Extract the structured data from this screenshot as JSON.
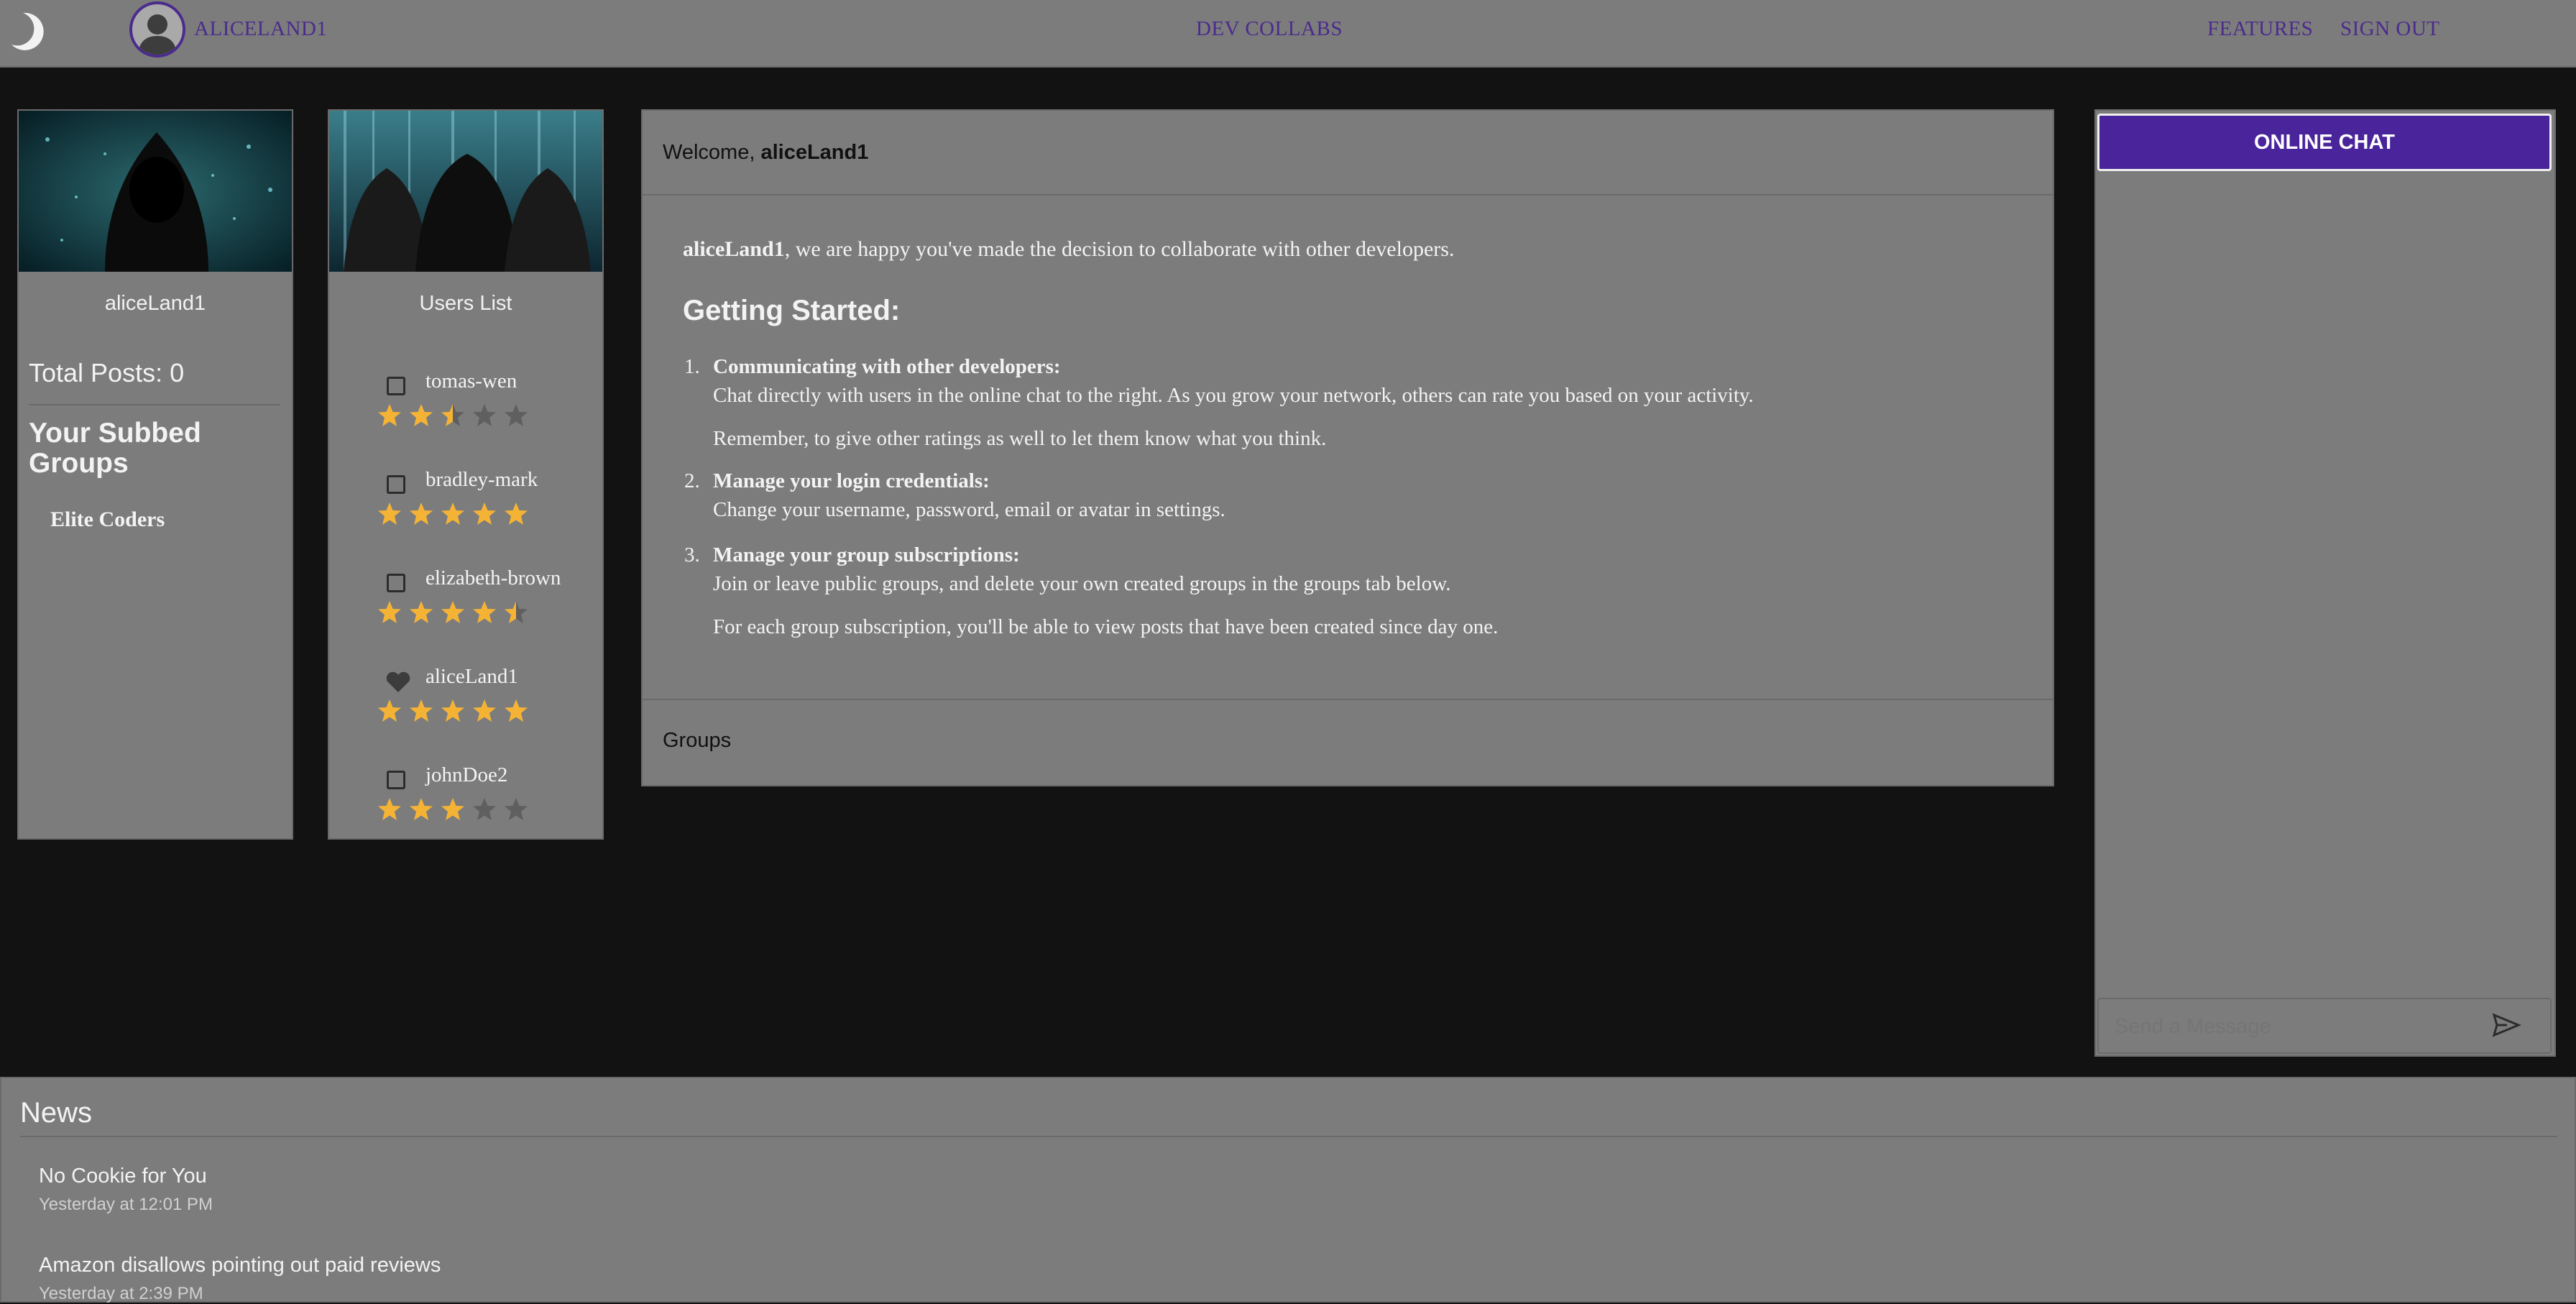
{
  "nav": {
    "username": "ALICELAND1",
    "brand": "DEV COLLABS",
    "features": "FEATURES",
    "signout": "SIGN OUT"
  },
  "profile": {
    "username": "aliceLand1",
    "total_posts": "Total Posts: 0",
    "subbed_heading": "Your Subbed Groups",
    "groups": [
      "Elite Coders"
    ]
  },
  "users": {
    "title": "Users List",
    "items": [
      {
        "name": "tomas-wen",
        "rating": 2.5,
        "icon": "checkbox-icon"
      },
      {
        "name": "bradley-mark",
        "rating": 5,
        "icon": "checkbox-icon"
      },
      {
        "name": "elizabeth-brown",
        "rating": 4.5,
        "icon": "checkbox-icon"
      },
      {
        "name": "aliceLand1",
        "rating": 5,
        "icon": "heart-icon"
      },
      {
        "name": "johnDoe2",
        "rating": 3,
        "icon": "checkbox-icon"
      }
    ]
  },
  "welcome": {
    "prefix": "Welcome,",
    "username": "aliceLand1",
    "intro_user": "aliceLand1",
    "intro_text": ", we are happy you've made the decision to collaborate with other developers.",
    "heading": "Getting Started:",
    "steps": [
      {
        "title": "Communicating with other developers:",
        "lines": [
          "Chat directly with users in the online chat to the right. As you grow your network, others can rate you based on your activity.",
          "Remember, to give other ratings as well to let them know what you think."
        ]
      },
      {
        "title": "Manage your login credentials:",
        "lines": [
          "Change your username, password, email or avatar in settings."
        ]
      },
      {
        "title": "Manage your group subscriptions:",
        "lines": [
          "Join or leave public groups, and delete your own created groups in the groups tab below.",
          "For each group subscription, you'll be able to view posts that have been created since day one."
        ]
      }
    ],
    "groups_tab": "Groups"
  },
  "chat": {
    "title": "ONLINE CHAT",
    "placeholder": "Send a Message",
    "accent": "#4a249a"
  },
  "news": {
    "title": "News",
    "items": [
      {
        "title": "No Cookie for You",
        "time": "Yesterday at 12:01 PM"
      },
      {
        "title": "Amazon disallows pointing out paid reviews",
        "time": "Yesterday at 2:39 PM"
      }
    ]
  },
  "colors": {
    "star": "#f5b335",
    "star_empty": "#5f5f5f",
    "nav_link": "#4b2b8d"
  }
}
